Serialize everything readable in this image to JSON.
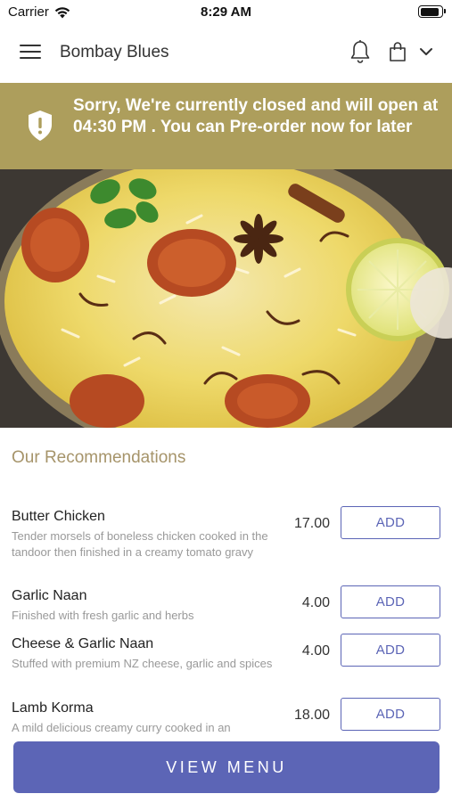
{
  "status_bar": {
    "carrier": "Carrier",
    "time": "8:29 AM",
    "battery_level": 0.92
  },
  "header": {
    "title": "Bombay Blues",
    "icons": [
      "menu-icon",
      "bell-icon",
      "shopping-bag-icon",
      "chevron-down-icon"
    ]
  },
  "banner": {
    "message": "Sorry, We're currently closed and will open at 04:30 PM . You can Pre-order now for later",
    "icon": "shield-alert-icon",
    "color": "#ad9e5c"
  },
  "section": {
    "title": "Our Recommendations"
  },
  "items": [
    {
      "name": "Butter Chicken",
      "description": "Tender morsels of boneless chicken cooked in the tandoor then finished in a creamy tomato gravy",
      "price": "17.00",
      "add_label": "ADD"
    },
    {
      "name": "Garlic Naan",
      "description": "Finished with fresh garlic and herbs",
      "price": "4.00",
      "add_label": "ADD"
    },
    {
      "name": "Cheese & Garlic Naan",
      "description": "Stuffed with premium NZ cheese, garlic and spices",
      "price": "4.00",
      "add_label": "ADD"
    },
    {
      "name": "Lamb Korma",
      "description": "A mild delicious creamy curry cooked in an",
      "price": "18.00",
      "add_label": "ADD"
    }
  ],
  "footer": {
    "view_menu_label": "VIEW MENU"
  },
  "colors": {
    "accent": "#5c65b6",
    "banner": "#ad9e5c",
    "section_title": "#a6946a"
  }
}
